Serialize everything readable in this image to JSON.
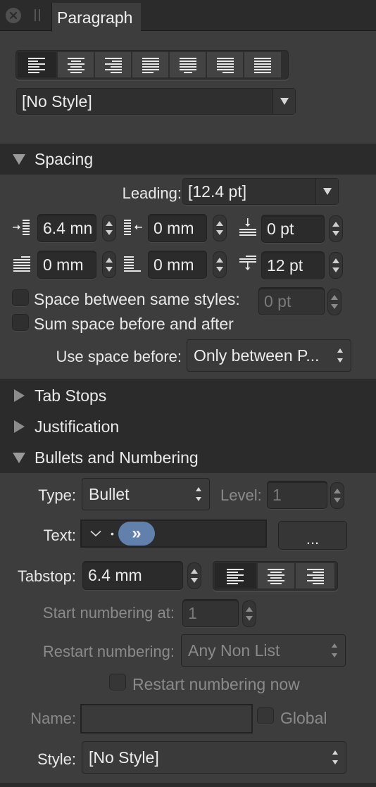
{
  "panel": {
    "tab_title": "Paragraph",
    "close_icon": "close-icon",
    "grip_icon": "drag-handle-icon"
  },
  "alignment": {
    "options": [
      {
        "name": "align-left",
        "active": true
      },
      {
        "name": "align-center",
        "active": false
      },
      {
        "name": "align-right",
        "active": false
      },
      {
        "name": "justify-left",
        "active": false
      },
      {
        "name": "justify-center",
        "active": false
      },
      {
        "name": "justify-right",
        "active": false
      },
      {
        "name": "justify-all",
        "active": false
      }
    ]
  },
  "paragraph_style": {
    "value": "[No Style]"
  },
  "spacing": {
    "header": "Spacing",
    "expanded": true,
    "leading_label": "Leading:",
    "leading_value": "[12.4 pt]",
    "left_indent": "6.4 mn",
    "right_indent": "0 mm",
    "space_before": "0 pt",
    "first_line_indent": "0 mm",
    "last_line_indent": "0 mm",
    "space_after": "12 pt",
    "space_between_same_label": "Space between same styles:",
    "space_between_same_value": "0 pt",
    "space_between_same_checked": false,
    "sum_space_label": "Sum space before and after",
    "sum_space_checked": false,
    "use_space_before_label": "Use space before:",
    "use_space_before_value": "Only between P..."
  },
  "tab_stops": {
    "header": "Tab Stops",
    "expanded": false
  },
  "justification": {
    "header": "Justification",
    "expanded": false
  },
  "bullets": {
    "header": "Bullets and Numbering",
    "expanded": true,
    "type_label": "Type:",
    "type_value": "Bullet",
    "level_label": "Level:",
    "level_value": "1",
    "text_label": "Text:",
    "text_token_dot": "•",
    "text_token_pill": "»",
    "text_dropdown_icon": "chevron-down-icon",
    "more_button": "...",
    "tabstop_label": "Tabstop:",
    "tabstop_value": "6.4 mm",
    "tabstop_align": [
      {
        "name": "align-left",
        "active": true
      },
      {
        "name": "align-center",
        "active": false
      },
      {
        "name": "align-right",
        "active": false
      }
    ],
    "start_numbering_label": "Start numbering at:",
    "start_numbering_value": "1",
    "restart_numbering_label": "Restart numbering:",
    "restart_numbering_value": "Any Non List",
    "restart_now_label": "Restart numbering now",
    "restart_now_checked": false,
    "name_label": "Name:",
    "name_value": "",
    "global_label": "Global",
    "global_checked": false,
    "style_label": "Style:",
    "style_value": "[No Style]",
    "accent_color": "#6180ab"
  }
}
